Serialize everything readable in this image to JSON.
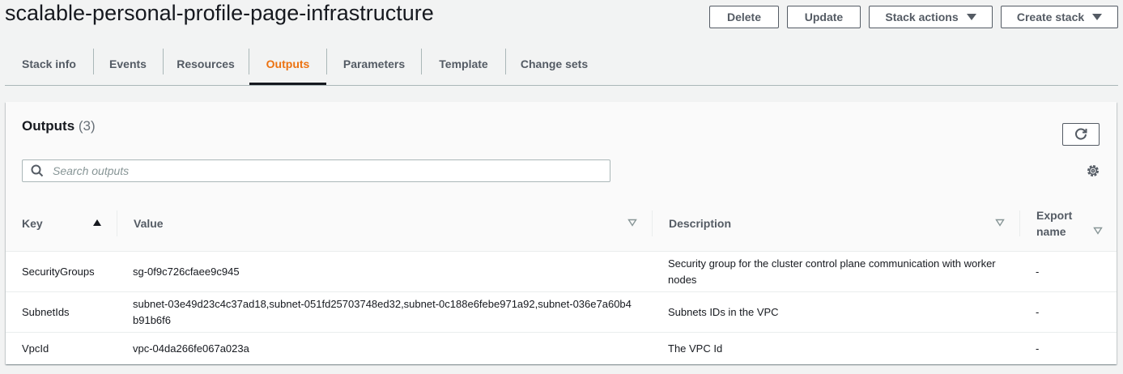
{
  "header": {
    "title": "scalable-personal-profile-page-infrastructure",
    "buttons": {
      "delete": "Delete",
      "update": "Update",
      "stack_actions": "Stack actions",
      "create_stack": "Create stack"
    }
  },
  "tabs": [
    "Stack info",
    "Events",
    "Resources",
    "Outputs",
    "Parameters",
    "Template",
    "Change sets"
  ],
  "active_tab": "Outputs",
  "panel": {
    "title": "Outputs",
    "count": "(3)",
    "search_placeholder": "Search outputs",
    "icons": {
      "refresh": "refresh-icon",
      "search": "search-icon",
      "settings": "gear-icon"
    }
  },
  "table": {
    "columns": {
      "key": "Key",
      "value": "Value",
      "description": "Description",
      "export_name": "Export name"
    },
    "sort": {
      "column": "Key",
      "direction": "ascending"
    },
    "rows": [
      {
        "key": "SecurityGroups",
        "value": "sg-0f9c726cfaee9c945",
        "description": "Security group for the cluster control plane communication with worker nodes",
        "export_name": "-"
      },
      {
        "key": "SubnetIds",
        "value": "subnet-03e49d23c4c37ad18,subnet-051fd25703748ed32,subnet-0c188e6febe971a92,subnet-036e7a60b4b91b6f6",
        "description": "Subnets IDs in the VPC",
        "export_name": "-"
      },
      {
        "key": "VpcId",
        "value": "vpc-04da266fe067a023a",
        "description": "The VPC Id",
        "export_name": "-"
      }
    ]
  },
  "colors": {
    "accent_active_tab": "#ec7211",
    "text": "#16191f",
    "muted": "#545b64",
    "background": "#f2f3f3"
  }
}
